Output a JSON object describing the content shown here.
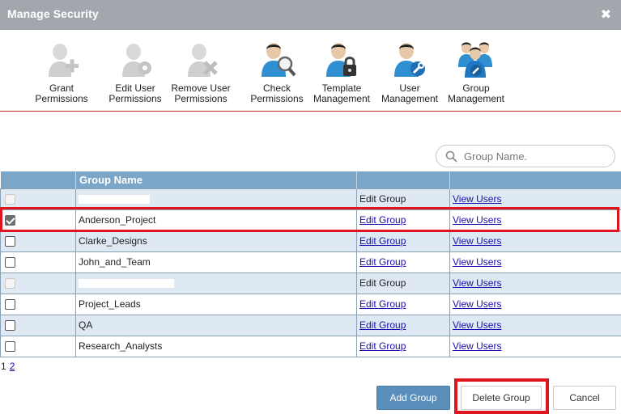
{
  "dialog": {
    "title": "Manage Security",
    "close_symbol": "✖"
  },
  "toolbar": [
    {
      "label": "Grant\nPermissions",
      "icon": "user-add-icon"
    },
    {
      "label": "Edit User\nPermissions",
      "icon": "user-gear-icon"
    },
    {
      "label": "Remove User\nPermissions",
      "icon": "user-remove-icon"
    },
    {
      "label": "Check\nPermissions",
      "icon": "user-magnifier-icon"
    },
    {
      "label": "Template\nManagement",
      "icon": "user-lock-icon"
    },
    {
      "label": "User\nManagement",
      "icon": "user-wrench-icon"
    },
    {
      "label": "Group\nManagement",
      "icon": "group-wrench-icon"
    }
  ],
  "search": {
    "placeholder": "Group Name."
  },
  "table": {
    "headers": [
      "",
      "Group Name",
      "",
      ""
    ],
    "rows": [
      {
        "name": "",
        "checked": false,
        "disabled": true,
        "edit": "Edit Group",
        "edit_is_link": false,
        "view": "View Users"
      },
      {
        "name": "Anderson_Project",
        "checked": true,
        "disabled": false,
        "edit": "Edit Group",
        "edit_is_link": true,
        "view": "View Users"
      },
      {
        "name": "Clarke_Designs",
        "checked": false,
        "disabled": false,
        "edit": "Edit Group",
        "edit_is_link": true,
        "view": "View Users"
      },
      {
        "name": "John_and_Team",
        "checked": false,
        "disabled": false,
        "edit": "Edit Group",
        "edit_is_link": true,
        "view": "View Users"
      },
      {
        "name": "",
        "checked": false,
        "disabled": true,
        "edit": "Edit Group",
        "edit_is_link": false,
        "view": "View Users"
      },
      {
        "name": "Project_Leads",
        "checked": false,
        "disabled": false,
        "edit": "Edit Group",
        "edit_is_link": true,
        "view": "View Users"
      },
      {
        "name": "QA",
        "checked": false,
        "disabled": false,
        "edit": "Edit Group",
        "edit_is_link": true,
        "view": "View Users"
      },
      {
        "name": "Research_Analysts",
        "checked": false,
        "disabled": false,
        "edit": "Edit Group",
        "edit_is_link": true,
        "view": "View Users"
      }
    ]
  },
  "pager": {
    "current": "1",
    "next": "2"
  },
  "buttons": {
    "add": "Add Group",
    "delete": "Delete Group",
    "cancel": "Cancel"
  },
  "colors": {
    "titlebar": "#a3a7ad",
    "header": "#7ca6c7",
    "row_alt": "#dfe9f3",
    "highlight": "#e0141e",
    "primary": "#5b8fbb",
    "divider": "#c0392b"
  }
}
